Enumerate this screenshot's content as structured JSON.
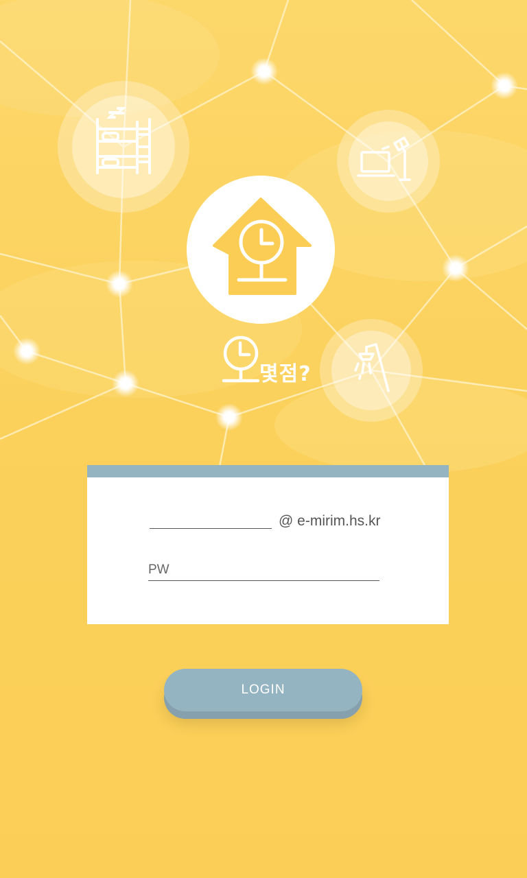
{
  "app": {
    "name_suffix": "몇점?"
  },
  "login": {
    "id_value": "",
    "domain": "@ e-mirim.hs.kr",
    "pw_placeholder": "PW",
    "button_label": "LOGIN"
  },
  "colors": {
    "background": "#fcd45f",
    "accent": "#95b4c2",
    "icon_fill": "#fbcd55",
    "white": "#ffffff"
  },
  "icons": [
    "bunk-bed-icon",
    "laptop-lamp-icon",
    "house-clock-icon",
    "shower-icon",
    "clock-logo-icon"
  ]
}
